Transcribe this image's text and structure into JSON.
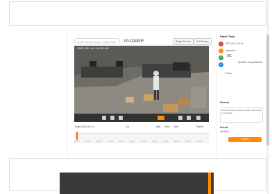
{
  "toolbar": {
    "search_placeholder": "Enter device name, press Enter",
    "camera_name": "00-ONWIF",
    "btn_single": "Single Screen",
    "btn_full": "Full Screen"
  },
  "video": {
    "timestamp": "2022-09-14 11:38:06"
  },
  "nav": {
    "date": "Today 2022-09-14",
    "zoom_label": "1/4",
    "mode_a": "Day",
    "mode_b": "Hour",
    "mode_c": "Min",
    "export": "Export"
  },
  "timeline": {
    "ticks": [
      "00:00",
      "02:00",
      "04:00",
      "06:00",
      "08:00",
      "10:00",
      "12:00",
      "14:00",
      "16:00",
      "18:00",
      "20:00",
      "22:00"
    ]
  },
  "sidebar": {
    "title": "Patrol Task",
    "item1_label": "2022-09-14 10:14",
    "item2_label": "Inspection",
    "item3_label": "Points",
    "count1": "0/1",
    "stat_a": "Qualified",
    "stat_b": "Unqualified",
    "stat_c": "N/A",
    "section_label": "Remark",
    "note": "Fire exit blocked, please remove the boxes immediately.",
    "result_label": "Result",
    "result_value": "Qualified",
    "submit": "Submit"
  },
  "colors": {
    "accent": "#ff8a00",
    "badge_red": "#e53935",
    "badge_green": "#43a047",
    "badge_blue": "#1e88e5"
  }
}
